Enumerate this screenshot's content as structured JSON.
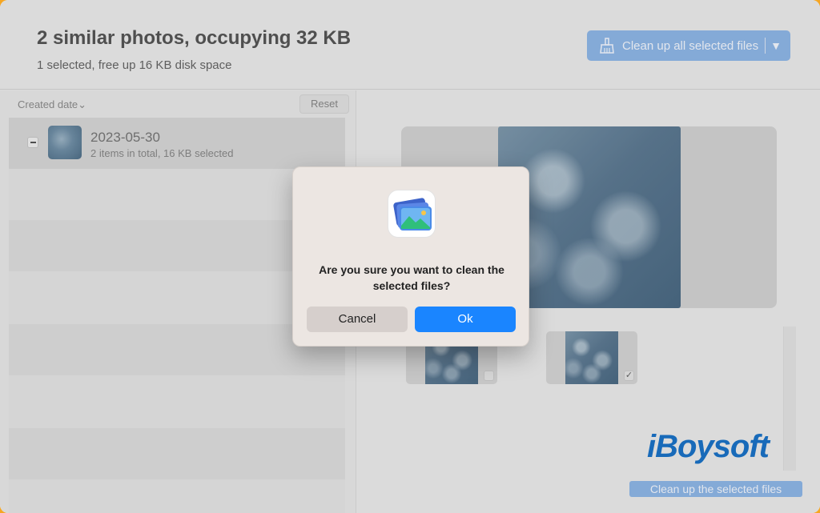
{
  "header": {
    "title": "2 similar photos, occupying 32 KB",
    "subtitle": "1 selected, free up 16 KB disk space",
    "cleanup_all_label": "Clean up all selected files"
  },
  "list": {
    "sort_label": "Created date",
    "reset_label": "Reset",
    "group": {
      "date": "2023-05-30",
      "info": "2 items in total, 16 KB selected",
      "selection_state": "partial"
    }
  },
  "thumbnails": [
    {
      "checked": false
    },
    {
      "checked": true
    }
  ],
  "watermark": "iBoysoft",
  "cleanup_selected_label": "Clean up the selected files",
  "dialog": {
    "icon": "photos-app-icon",
    "message": "Are you sure you want to clean the selected files?",
    "cancel_label": "Cancel",
    "ok_label": "Ok"
  },
  "colors": {
    "accent": "#1a85ff",
    "disabled_accent": "#8fb7e8"
  }
}
